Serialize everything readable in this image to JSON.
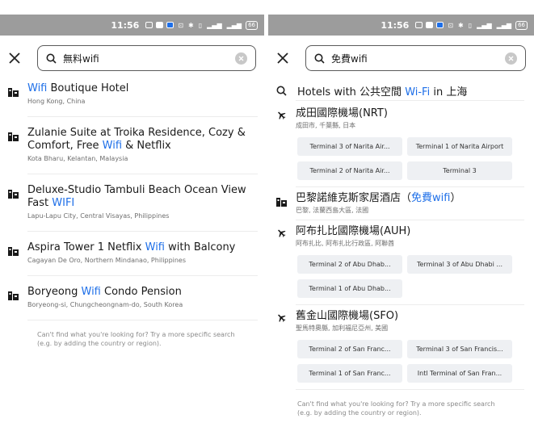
{
  "left": {
    "status": {
      "time": "11:56",
      "battery": "66"
    },
    "search": {
      "value": "無料wifi"
    },
    "results": [
      {
        "name_parts": [
          "",
          "Wifi",
          " Boutique Hotel"
        ],
        "location": "Hong Kong, China"
      },
      {
        "name_parts": [
          "Zulanie Suite at Troika Residence, Cozy & Comfort, Free ",
          "Wifi",
          " & Netflix"
        ],
        "location": "Kota Bharu, Kelantan, Malaysia"
      },
      {
        "name_parts": [
          "Deluxe-Studio Tambuli Beach Ocean View Fast ",
          "WIFI",
          ""
        ],
        "location": "Lapu-Lapu City, Central Visayas, Philippines"
      },
      {
        "name_parts": [
          "Aspira Tower 1 Netflix ",
          "Wifi",
          " with Balcony"
        ],
        "location": "Cagayan De Oro, Northern Mindanao, Philippines"
      },
      {
        "name_parts": [
          "Boryeong ",
          "Wifi",
          " Condo Pension"
        ],
        "location": "Boryeong-si, Chungcheongnam-do, South Korea"
      }
    ],
    "hint": "Can't find what you're looking for? Try a more specific search (e.g. by adding the country or region)."
  },
  "right": {
    "status": {
      "time": "11:56",
      "battery": "66"
    },
    "search": {
      "value": "免費wifi"
    },
    "hotels_with": {
      "prefix": "Hotels with 公共空間 ",
      "highlight": "Wi-Fi",
      "suffix": " in 上海"
    },
    "airport_1": {
      "name": "成田國際機場(NRT)",
      "location": "成田市, 千葉縣, 日本",
      "terminals": [
        "Terminal 3 of Narita Air...",
        "Terminal 1 of Narita Airport",
        "Terminal 2 of Narita Air...",
        "Terminal 3"
      ]
    },
    "hotel_paris": {
      "name": "巴黎諾維克斯家居酒店（",
      "highlight": "免費wifi",
      "name_end": "）",
      "location": "巴黎, 法蘭西島大區, 法國"
    },
    "airport_2": {
      "name": "阿布扎比國際機場(AUH)",
      "location": "阿布扎比, 阿布扎比行政區, 阿聯酋",
      "terminals": [
        "Terminal 2 of Abu Dhab...",
        "Terminal 3 of Abu Dhabi ...",
        "Terminal 1 of Abu Dhab..."
      ]
    },
    "airport_3": {
      "name": "舊金山國際機場(SFO)",
      "location": "聖馬特奧縣, 加利福尼亞州, 美國",
      "terminals": [
        "Terminal 2 of San Franc...",
        "Terminal 3 of San Francis...",
        "Terminal 1 of San Franc...",
        "Intl Terminal of San Fran..."
      ]
    },
    "hint": "Can't find what you're looking for? Try a more specific search (e.g. by adding the country or region)."
  },
  "colors": {
    "accent": "#1e6fe8",
    "status_bar": "#9c9c9c"
  },
  "icons": {
    "close": "close-icon",
    "search": "search-icon",
    "clear": "clear-icon",
    "hotel": "hotel-icon",
    "airport": "airplane-icon"
  }
}
